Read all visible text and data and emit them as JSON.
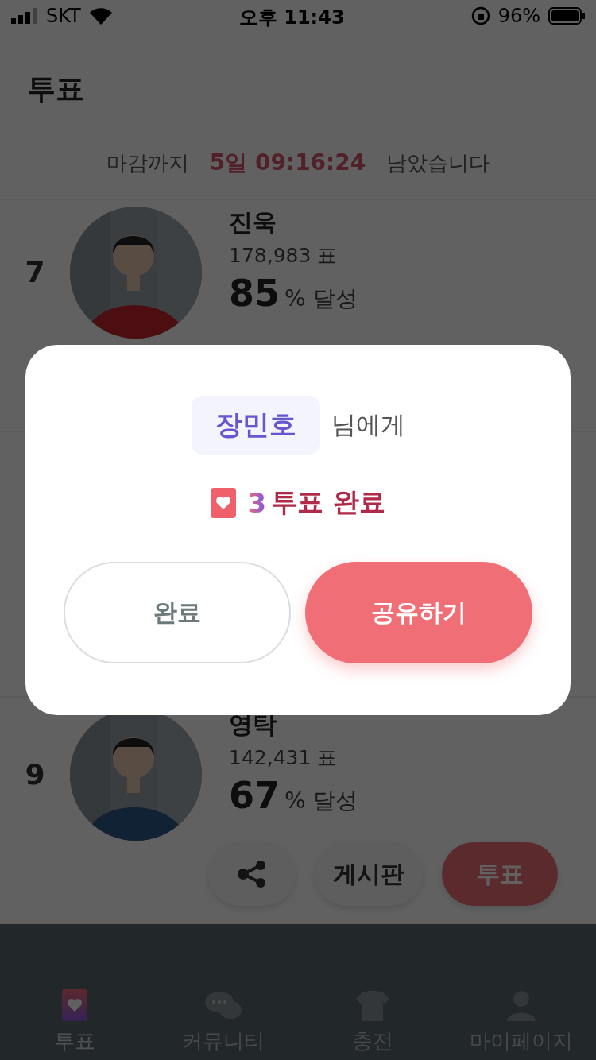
{
  "status_bar": {
    "carrier": "SKT",
    "time": "오후 11:43",
    "battery": "96%"
  },
  "header": {
    "title": "투표"
  },
  "deadline": {
    "prefix": "마감까지",
    "countdown": "5일 09:16:24",
    "suffix": "남았습니다"
  },
  "candidates": [
    {
      "rank": "7",
      "name": "진욱",
      "votes": "178,983 표",
      "percent": "85",
      "percent_unit": "% 달성"
    },
    {
      "rank": "9",
      "name": "영탁",
      "votes": "142,431 표",
      "percent": "67",
      "percent_unit": "% 달성",
      "board_label": "게시판",
      "vote_label": "투표"
    }
  ],
  "tabs": [
    {
      "label": "투표",
      "selected": true
    },
    {
      "label": "커뮤니티",
      "selected": false
    },
    {
      "label": "충전",
      "selected": false
    },
    {
      "label": "마이페이지",
      "selected": false
    }
  ],
  "modal": {
    "recipient": "장민호",
    "recipient_suffix": "님에게",
    "vote_count": "3",
    "vote_text": "투표 완료",
    "buttons": [
      {
        "label": "완료",
        "kind": "secondary"
      },
      {
        "label": "공유하기",
        "kind": "primary"
      }
    ]
  }
}
